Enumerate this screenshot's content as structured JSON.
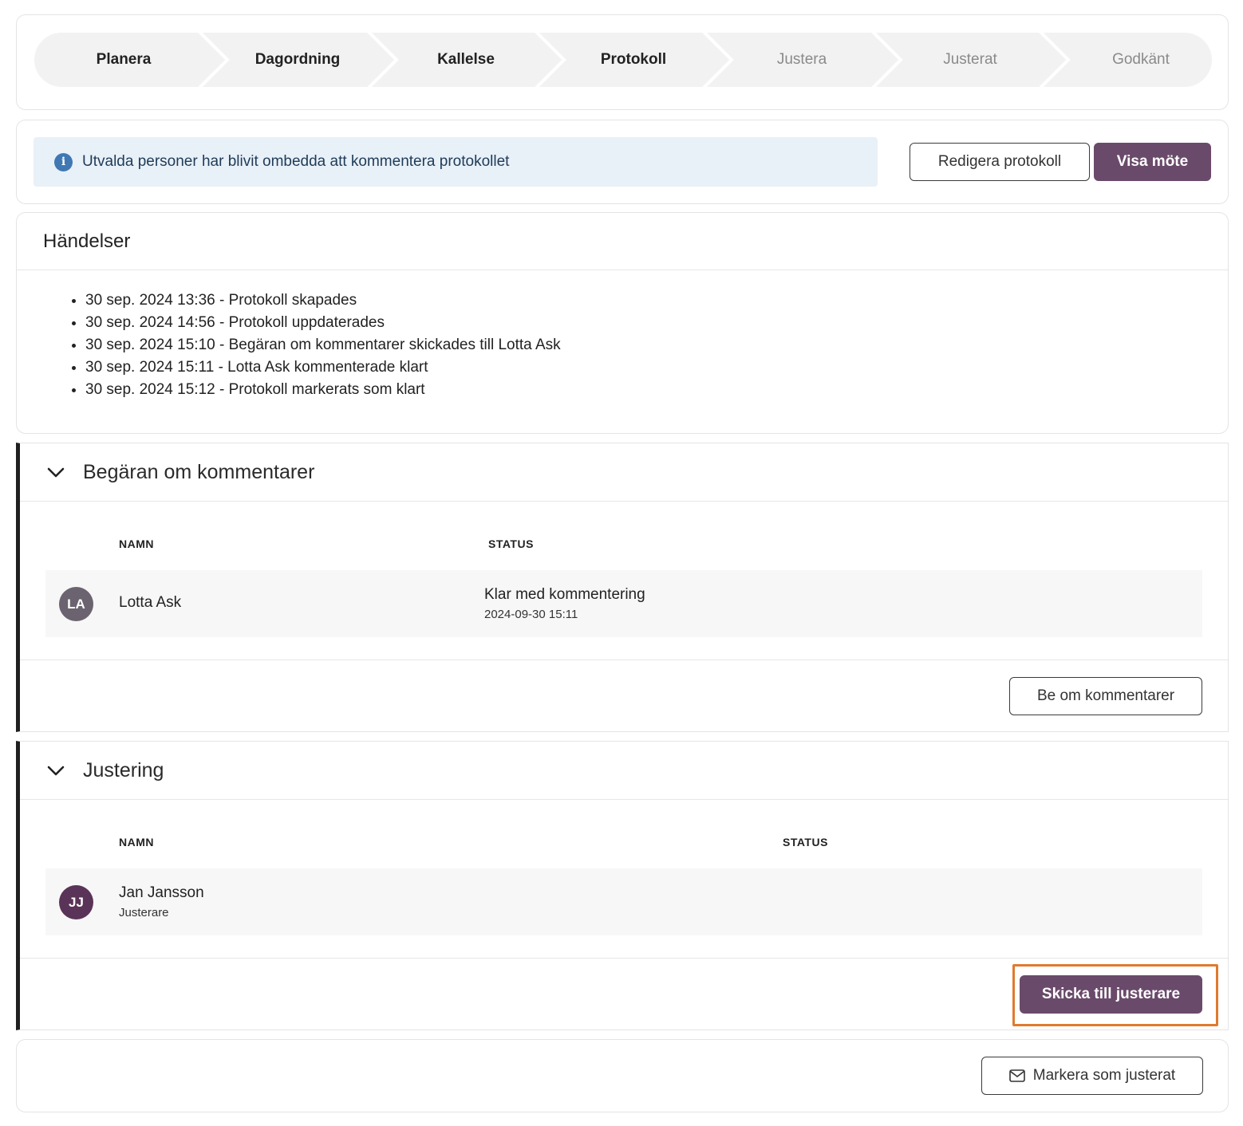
{
  "stepper": {
    "steps": [
      {
        "label": "Planera",
        "state": "done"
      },
      {
        "label": "Dagordning",
        "state": "done"
      },
      {
        "label": "Kallelse",
        "state": "done"
      },
      {
        "label": "Protokoll",
        "state": "current"
      },
      {
        "label": "Justera",
        "state": "pending"
      },
      {
        "label": "Justerat",
        "state": "pending"
      },
      {
        "label": "Godkänt",
        "state": "pending"
      }
    ]
  },
  "info": {
    "message": "Utvalda personer har blivit ombedda att kommentera protokollet",
    "icon": "info-icon",
    "edit_button": "Redigera protokoll",
    "view_button": "Visa möte"
  },
  "events": {
    "title": "Händelser",
    "items": [
      "30 sep. 2024 13:36 - Protokoll skapades",
      "30 sep. 2024 14:56 - Protokoll uppdaterades",
      "30 sep. 2024 15:10 - Begäran om kommentarer skickades till Lotta Ask",
      "30 sep. 2024 15:11 - Lotta Ask kommenterade klart",
      "30 sep. 2024 15:12 - Protokoll markerats som klart"
    ]
  },
  "comments": {
    "title": "Begäran om kommentarer",
    "col_name": "NAMN",
    "col_status": "STATUS",
    "rows": [
      {
        "initials": "LA",
        "name": "Lotta Ask",
        "status": "Klar med kommentering",
        "status_date": "2024-09-30 15:11",
        "avatar_color": "#6b6470"
      }
    ],
    "button": "Be om kommentarer"
  },
  "adjust": {
    "title": "Justering",
    "col_name": "NAMN",
    "col_status": "STATUS",
    "rows": [
      {
        "initials": "JJ",
        "name": "Jan Jansson",
        "role": "Justerare",
        "avatar_color": "#5a3358"
      }
    ],
    "button": "Skicka till justerare"
  },
  "bottom": {
    "button": "Markera som justerat",
    "icon": "mail-icon"
  },
  "colors": {
    "primary": "#6a4a6a",
    "info_bg": "#e8f0f8",
    "highlight": "#e07a2e"
  }
}
